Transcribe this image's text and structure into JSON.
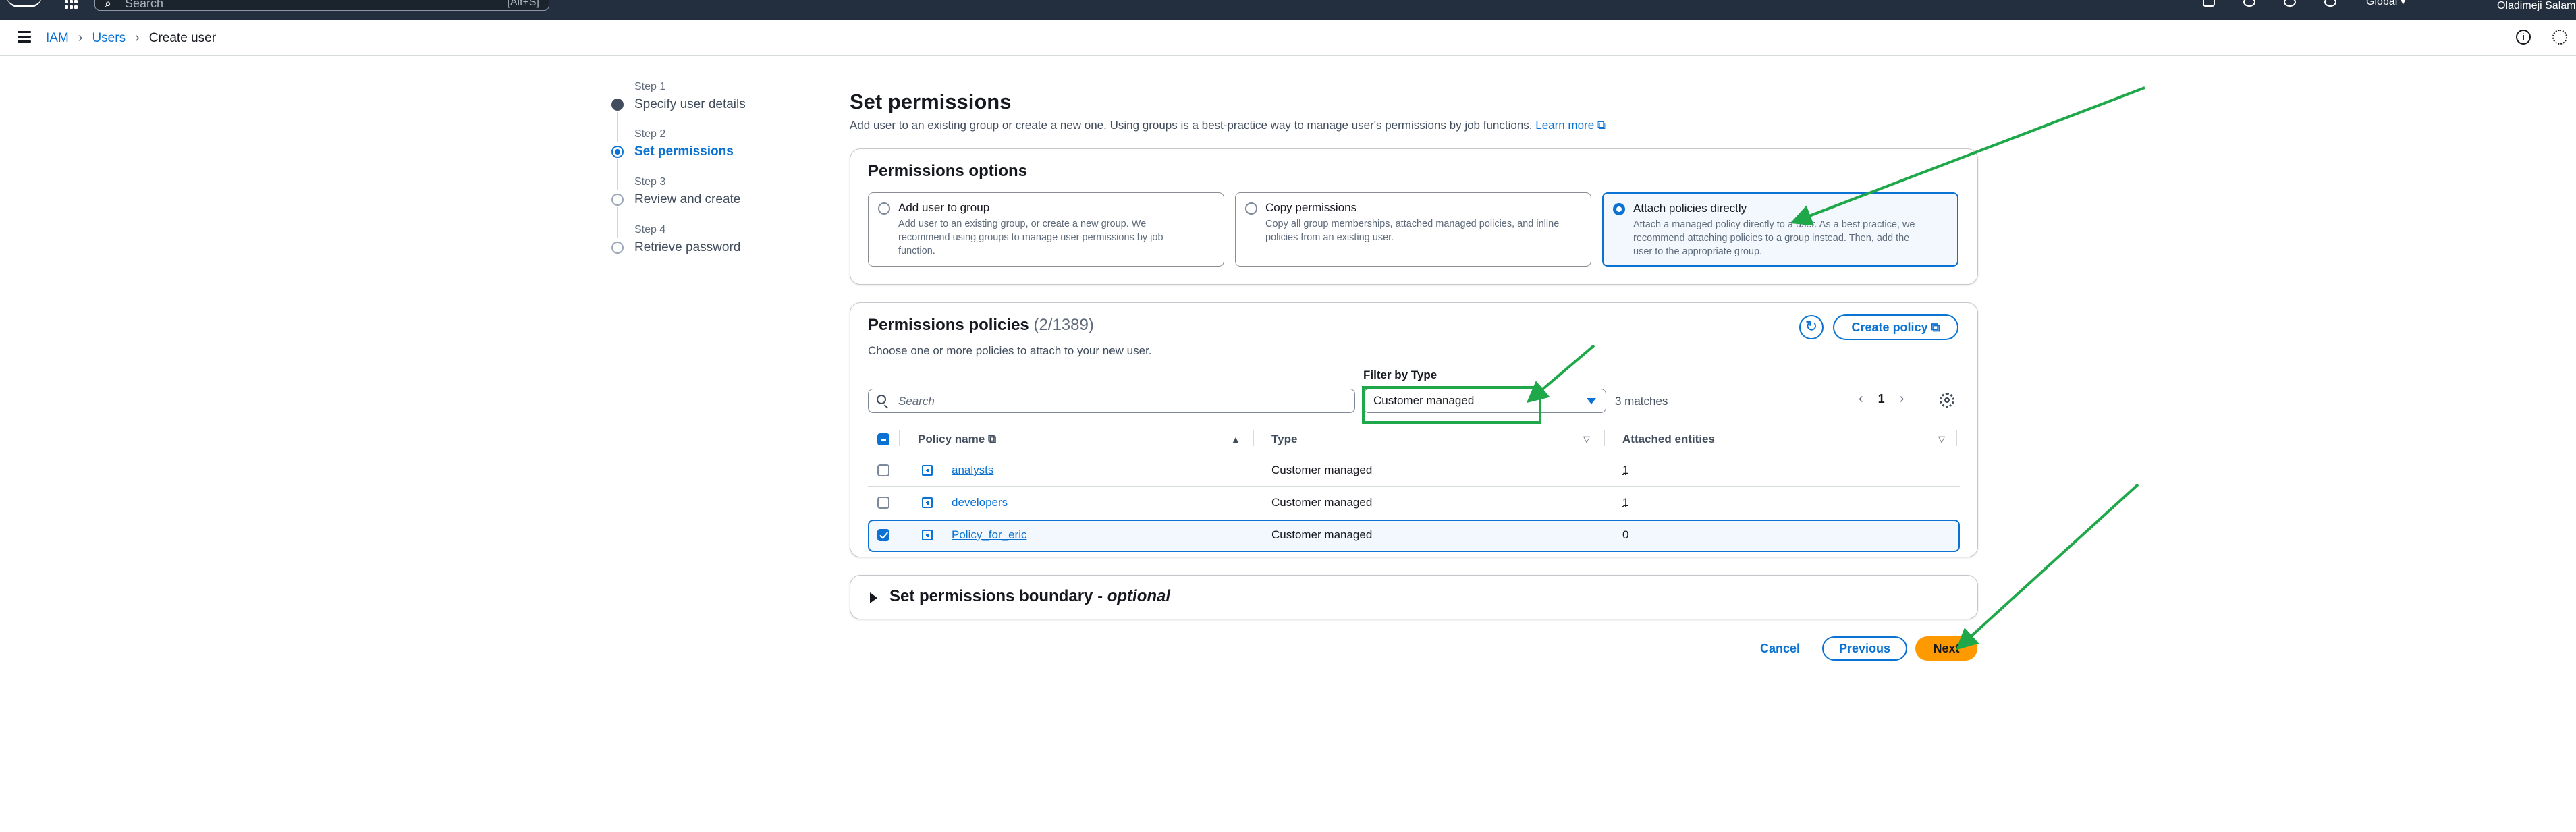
{
  "topbar": {
    "search_placeholder": "Search",
    "search_shortcut": "[Alt+S]",
    "region": "Global ▾",
    "user": "Oladimeji Salam"
  },
  "breadcrumb": {
    "items": [
      "IAM",
      "Users"
    ],
    "current": "Create user"
  },
  "steps": [
    {
      "label": "Step 1",
      "name": "Specify user details"
    },
    {
      "label": "Step 2",
      "name": "Set permissions"
    },
    {
      "label": "Step 3",
      "name": "Review and create"
    },
    {
      "label": "Step 4",
      "name": "Retrieve password"
    }
  ],
  "page": {
    "title": "Set permissions",
    "subtitle": "Add user to an existing group or create a new one. Using groups is a best-practice way to manage user's permissions by job functions.",
    "learn_more": "Learn more"
  },
  "permissions_options": {
    "title": "Permissions options",
    "options": [
      {
        "title": "Add user to group",
        "desc": "Add user to an existing group, or create a new group. We recommend using groups to manage user permissions by job function.",
        "selected": false
      },
      {
        "title": "Copy permissions",
        "desc": "Copy all group memberships, attached managed policies, and inline policies from an existing user.",
        "selected": false
      },
      {
        "title": "Attach policies directly",
        "desc": "Attach a managed policy directly to a user. As a best practice, we recommend attaching policies to a group instead. Then, add the user to the appropriate group.",
        "selected": true
      }
    ]
  },
  "policies": {
    "title": "Permissions policies",
    "count": "(2/1389)",
    "description": "Choose one or more policies to attach to your new user.",
    "create_policy": "Create policy",
    "search_placeholder": "Search",
    "filter_label": "Filter by Type",
    "filter_value": "Customer managed",
    "matches": "3 matches",
    "page": "1",
    "columns": {
      "name": "Policy name",
      "type": "Type",
      "attached": "Attached entities"
    },
    "rows": [
      {
        "name": "analysts",
        "type": "Customer managed",
        "attached": "1",
        "checked": false
      },
      {
        "name": "developers",
        "type": "Customer managed",
        "attached": "1",
        "checked": false
      },
      {
        "name": "Policy_for_eric",
        "type": "Customer managed",
        "attached": "0",
        "checked": true
      }
    ]
  },
  "boundary": {
    "title": "Set permissions boundary - ",
    "optional": "optional"
  },
  "footer": {
    "cancel": "Cancel",
    "previous": "Previous",
    "next": "Next"
  },
  "colors": {
    "primary": "#0972d3",
    "accent": "#ff9900",
    "annotation": "#1ea84a",
    "header_bg": "#232f3e"
  }
}
